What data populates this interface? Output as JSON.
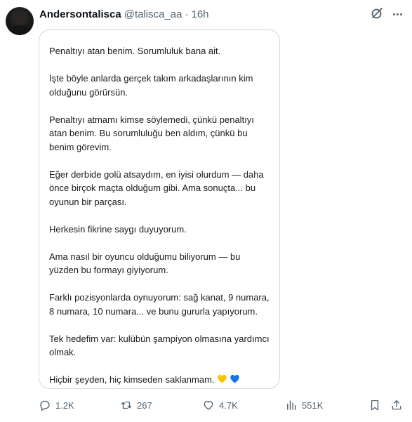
{
  "tweet": {
    "display_name": "Andersontalisca",
    "handle": "@talisca_aa",
    "separator": "·",
    "time": "16h"
  },
  "icons": {
    "avatar": "profile-avatar",
    "grok": "grok-slash-icon",
    "more": "more-dots-icon",
    "reply": "reply-bubble-icon",
    "retweet": "retweet-arrows-icon",
    "like": "heart-outline-icon",
    "views": "views-bars-icon",
    "bookmark": "bookmark-icon",
    "share": "share-upload-icon"
  },
  "card": {
    "paragraphs": [
      "Penaltıyı atan benim. Sorumluluk bana ait.",
      "İşte böyle anlarda gerçek takım arkadaşlarının kim olduğunu görürsün.",
      "Penaltıyı atmamı kimse söylemedi, çünkü penaltıyı atan benim. Bu sorumluluğu ben aldım, çünkü bu benim görevim.",
      "Eğer derbide golü atsaydım, en iyisi olurdum — daha önce birçok maçta olduğum gibi. Ama sonuçta... bu oyunun bir parçası.",
      "Herkesin fikrine saygı duyuyorum.",
      "Ama nasıl bir oyuncu olduğumu biliyorum — bu yüzden bu formayı giyiyorum.",
      "Farklı pozisyonlarda oynuyorum: sağ kanat, 9 numara, 8 numara, 10 numara... ve bunu gururla yapıyorum.",
      "Tek hedefim var: kulübün şampiyon olmasına yardımcı olmak.",
      "Hiçbir şeyden, hiç kimseden saklanmam."
    ],
    "emoji_colors": [
      "#f7c600",
      "#1a74e8"
    ]
  },
  "stats": {
    "replies": "1.2K",
    "retweets": "267",
    "likes": "4.7K",
    "views": "551K"
  },
  "colors": {
    "text_primary": "#0f1419",
    "text_secondary": "#536471",
    "border": "#cfd9de"
  }
}
